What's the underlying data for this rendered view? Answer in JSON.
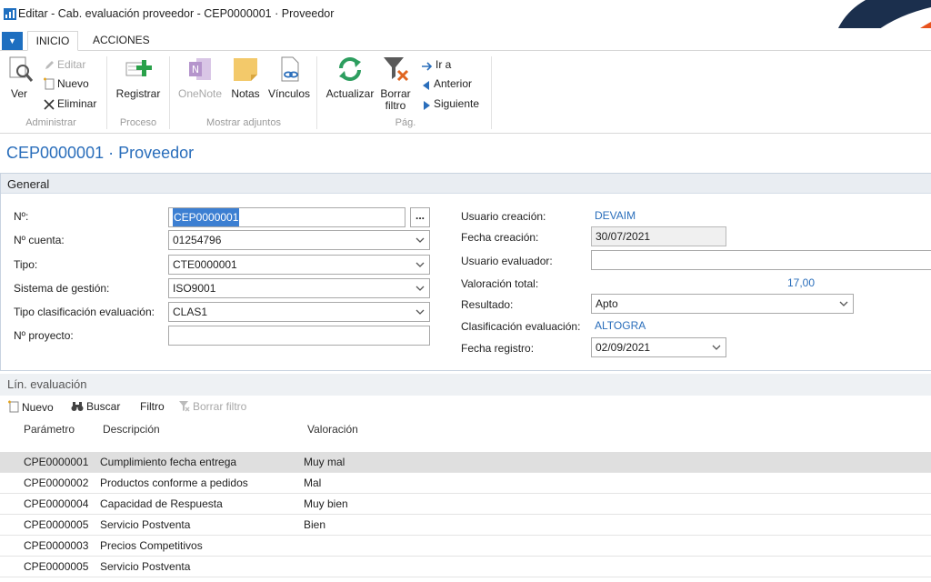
{
  "window": {
    "title": "Editar - Cab. evaluación proveedor - CEP0000001 · Proveedor"
  },
  "tabs": {
    "inicio": "INICIO",
    "acciones": "ACCIONES"
  },
  "ribbon": {
    "administrar": {
      "label": "Administrar",
      "ver": "Ver",
      "editar": "Editar",
      "nuevo": "Nuevo",
      "eliminar": "Eliminar"
    },
    "proceso": {
      "label": "Proceso",
      "registrar": "Registrar"
    },
    "adjuntos": {
      "label": "Mostrar adjuntos",
      "onenote": "OneNote",
      "notas": "Notas",
      "vinculos": "Vínculos"
    },
    "pag": {
      "label": "Pág.",
      "actualizar": "Actualizar",
      "borrar_filtro_l1": "Borrar",
      "borrar_filtro_l2": "filtro",
      "ir_a": "Ir a",
      "anterior": "Anterior",
      "siguiente": "Siguiente"
    }
  },
  "page_title": "CEP0000001 · Proveedor",
  "general": {
    "title": "General",
    "left": {
      "no_label": "Nº:",
      "no_value": "CEP0000001",
      "cuenta_label": "Nº cuenta:",
      "cuenta_value": "01254796",
      "tipo_label": "Tipo:",
      "tipo_value": "CTE0000001",
      "sistema_label": "Sistema de gestión:",
      "sistema_value": "ISO9001",
      "clasif_label": "Tipo clasificación evaluación:",
      "clasif_value": "CLAS1",
      "proyecto_label": "Nº proyecto:",
      "proyecto_value": "",
      "lookup": "..."
    },
    "right": {
      "usuario_creacion_label": "Usuario creación:",
      "usuario_creacion_value": "DEVAIM",
      "fecha_creacion_label": "Fecha creación:",
      "fecha_creacion_value": "30/07/2021",
      "usuario_evaluador_label": "Usuario evaluador:",
      "usuario_evaluador_value": "",
      "valoracion_label": "Valoración total:",
      "valoracion_value": "17,00",
      "resultado_label": "Resultado:",
      "resultado_value": "Apto",
      "clasificacion_label": "Clasificación evaluación:",
      "clasificacion_value": "ALTOGRA",
      "fecha_registro_label": "Fecha registro:",
      "fecha_registro_value": "02/09/2021"
    }
  },
  "lines": {
    "title": "Lín. evaluación",
    "toolbar": {
      "nuevo": "Nuevo",
      "buscar": "Buscar",
      "filtro": "Filtro",
      "borrar_filtro": "Borrar filtro"
    },
    "columns": {
      "parametro": "Parámetro",
      "descripcion": "Descripción",
      "valoracion": "Valoración"
    },
    "rows": [
      {
        "parametro": "CPE0000001",
        "descripcion": "Cumplimiento fecha entrega",
        "valoracion": "Muy mal"
      },
      {
        "parametro": "CPE0000002",
        "descripcion": "Productos conforme a pedidos",
        "valoracion": "Mal"
      },
      {
        "parametro": "CPE0000004",
        "descripcion": "Capacidad de Respuesta",
        "valoracion": "Muy bien"
      },
      {
        "parametro": "CPE0000005",
        "descripcion": "Servicio Postventa",
        "valoracion": "Bien"
      },
      {
        "parametro": "CPE0000003",
        "descripcion": "Precios Competitivos",
        "valoracion": ""
      },
      {
        "parametro": "CPE0000005",
        "descripcion": "Servicio Postventa",
        "valoracion": ""
      }
    ]
  },
  "colors": {
    "accent": "#1e6fc0",
    "link": "#2a6ebb",
    "logo_navy": "#1b2f4d",
    "logo_orange": "#e8521c"
  }
}
